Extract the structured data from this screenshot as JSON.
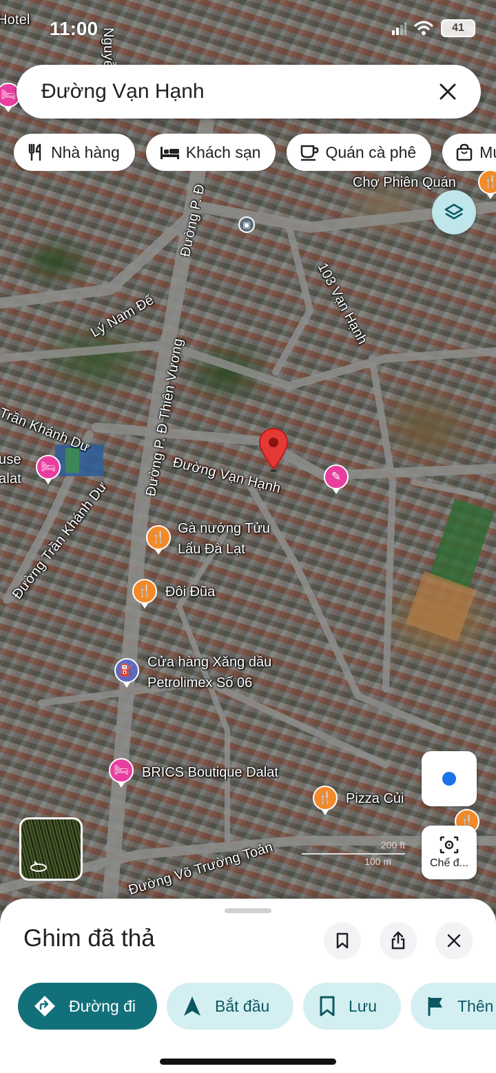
{
  "status_bar": {
    "time": "11:00",
    "battery": "41"
  },
  "search": {
    "query": "Đường Vạn Hạnh"
  },
  "chips": [
    {
      "label": "Nhà hàng",
      "icon": "fork-knife-icon"
    },
    {
      "label": "Khách sạn",
      "icon": "bed-icon"
    },
    {
      "label": "Quán cà phê",
      "icon": "coffee-cup-icon"
    },
    {
      "label": "Mu",
      "icon": "shopping-bag-icon"
    }
  ],
  "map": {
    "street_labels": {
      "nguyen": "Nguyễn",
      "duong_p_d_top": "Đường P. Đ",
      "ly_nam_de": "Lý Nam Đế",
      "duong_p_d_thien_vuong": "Đường P. Đ Thiên Vương",
      "tran_khanh_du": "Trần Khánh Dư",
      "duong_tran_khanh_du": "Đường Trần Khánh Dư",
      "duong_van_hanh": "Đường Vạn Hạnh",
      "van_hanh_103": "103 Vạn Hạnh",
      "duong_vo_truong_toan": "Đường Võ Trường Toản",
      "hotel_edge": "Hotel",
      "use_edge": "use",
      "alat_edge": "alat"
    },
    "places": {
      "cho_phien_quan": "Chợ Phiên Quán",
      "ga_nuong_line1": "Gà nướng Tửu",
      "ga_nuong_line2": "Lẩu Đà Lạt",
      "doi_dua": "Đôi Đũa",
      "xang_dau_line1": "Cửa hàng Xăng dầu",
      "xang_dau_line2": "Petrolimex Số 06",
      "brics": "BRICS Boutique Dalat",
      "pizza": "Pizza Củi"
    },
    "scale": {
      "top": "200 ft",
      "bottom": "100 m"
    },
    "lens_label": "Chế đ..."
  },
  "sheet": {
    "title": "Ghim đã thả",
    "actions": [
      {
        "label": "Đường đi",
        "icon": "directions-icon"
      },
      {
        "label": "Bắt đầu",
        "icon": "navigation-arrow-icon"
      },
      {
        "label": "Lưu",
        "icon": "bookmark-icon"
      },
      {
        "label": "Thên",
        "icon": "flag-icon"
      }
    ]
  },
  "colors": {
    "accent": "#12707a",
    "chip_bg": "#d4eff2",
    "pin": "#e53935",
    "poi_food": "#f28a2a",
    "poi_hotel": "#e83e9f"
  }
}
